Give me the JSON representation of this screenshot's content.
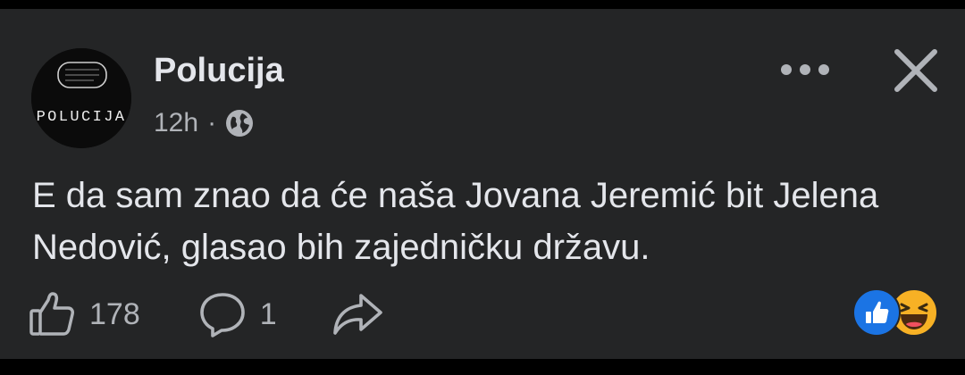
{
  "post": {
    "author": "Polucija",
    "time": "12h",
    "separator": "·",
    "privacy_icon": "globe-icon",
    "avatar_text": "POLUCIJA",
    "text": "E da sam znao da će naša Jovana Jeremić bit Jelena Nedović, glasao bih zajedničku državu."
  },
  "header": {
    "more_icon": "more-dots-icon",
    "close_icon": "close-icon"
  },
  "actions": {
    "like_count": "178",
    "comment_count": "1",
    "share_icon": "share-icon"
  },
  "reactions": [
    "like-reaction-icon",
    "haha-reaction-icon"
  ],
  "colors": {
    "background": "#242526",
    "text_primary": "#e4e6eb",
    "text_secondary": "#b0b3b8",
    "like_blue": "#1b74e4",
    "haha_yellow": "#f7b125"
  }
}
